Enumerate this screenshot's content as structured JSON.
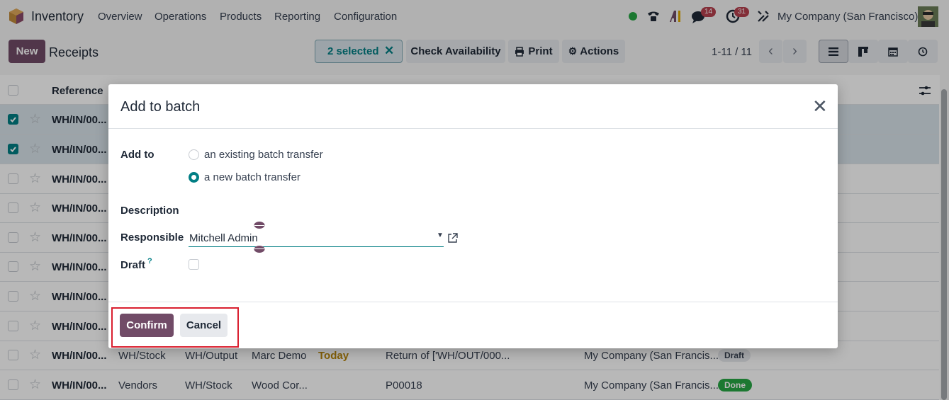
{
  "navbar": {
    "app_name": "Inventory",
    "menu": [
      "Overview",
      "Operations",
      "Products",
      "Reporting",
      "Configuration"
    ],
    "messages_badge": "14",
    "activities_badge": "31",
    "company": "My Company (San Francisco)",
    "status_color": "#28a745"
  },
  "control_panel": {
    "new_label": "New",
    "breadcrumb": "Receipts",
    "selected_label": "2 selected",
    "check_availability": "Check Availability",
    "print_label": "Print",
    "actions_label": "Actions",
    "pager": "1-11 / 11"
  },
  "list": {
    "header_reference": "Reference",
    "rows": [
      {
        "ref": "WH/IN/00...",
        "selected": true
      },
      {
        "ref": "WH/IN/00...",
        "selected": true
      },
      {
        "ref": "WH/IN/00...",
        "selected": false
      },
      {
        "ref": "WH/IN/00...",
        "selected": false
      },
      {
        "ref": "WH/IN/00...",
        "selected": false
      },
      {
        "ref": "WH/IN/00...",
        "selected": false
      },
      {
        "ref": "WH/IN/00...",
        "selected": false
      },
      {
        "ref": "WH/IN/00...",
        "selected": false
      },
      {
        "ref": "WH/IN/00...",
        "from": "WH/Stock",
        "to": "WH/Output",
        "contact": "Marc Demo",
        "date": "Today",
        "source": "Return of ['WH/OUT/000...",
        "company": "My Company (San Francis...",
        "status": "Draft"
      },
      {
        "ref": "WH/IN/00...",
        "from": "Vendors",
        "to": "WH/Stock",
        "contact": "Wood Cor...",
        "date": "",
        "source": "P00018",
        "company": "My Company (San Francis...",
        "status": "Done"
      }
    ]
  },
  "dialog": {
    "title": "Add to batch",
    "add_to_label": "Add to",
    "option_existing": "an existing batch transfer",
    "option_new": "a new batch transfer",
    "description_label": "Description",
    "responsible_label": "Responsible",
    "responsible_value": "Mitchell Admin",
    "draft_label": "Draft",
    "draft_help": "?",
    "confirm_label": "Confirm",
    "cancel_label": "Cancel"
  },
  "colors": {
    "primary": "#714b67",
    "accent": "#017e84",
    "highlight_box": "#d92030"
  }
}
